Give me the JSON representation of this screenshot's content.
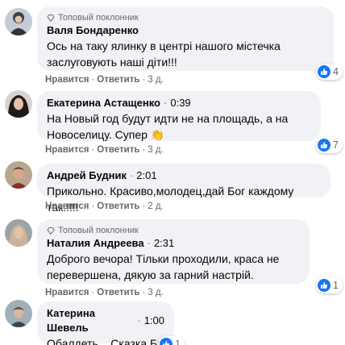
{
  "comments": [
    {
      "badge": "Топовый поклонник",
      "author": "Валя Бондаренко",
      "text_lines": [
        "Ось на таку ялинку в центрі нашого містечка",
        "заслуговують наші діти!!!"
      ],
      "like": "Нравится",
      "reply": "Ответить",
      "time": "3 д.",
      "reaction_count": "4"
    },
    {
      "author": "Екатерина Астащенко",
      "audio_time": "0:39",
      "text_lines": [
        "На Новый год будут идти не на площадь, а на",
        "Новоселицу. Супер 👏"
      ],
      "like": "Нравится",
      "reply": "Ответить",
      "time": "3 д.",
      "reaction_count": "7"
    },
    {
      "author": "Андрей Будник",
      "audio_time": "2:01",
      "text_lines": [
        "Прикольно. Красиво,молодец,дай Бог каждому так.!!!!"
      ],
      "like": "Нравится",
      "reply": "Ответить",
      "time": "2 д."
    },
    {
      "badge": "Топовый поклонник",
      "author": "Наталия Андреева",
      "audio_time": "2:31",
      "text_lines": [
        "Доброго вечора! Тільки проходили, краса не",
        "перевершена, дякую за гарний настрій."
      ],
      "like": "Нравится",
      "reply": "Ответить",
      "time": "3 д.",
      "reaction_count": "1"
    },
    {
      "author": "Катерина Шевель",
      "audio_time": "1:00",
      "text_lines": [
        "Обалдеть....Сказка.Браво."
      ],
      "reaction_count": "1"
    }
  ],
  "colors": {
    "bubble": "#f0f2f5",
    "secondary_text": "#65676b",
    "like_blue": "#1877f2"
  }
}
